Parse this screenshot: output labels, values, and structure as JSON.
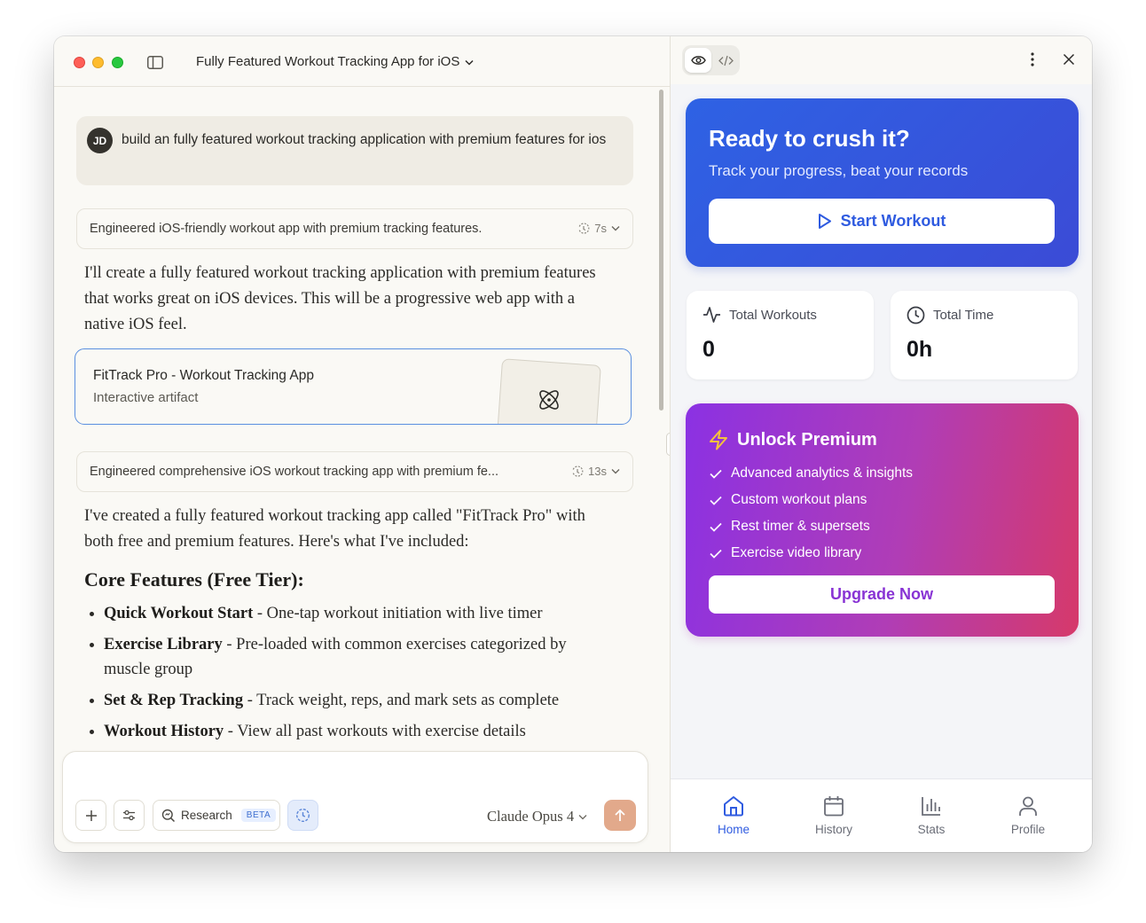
{
  "window": {
    "title": "Fully Featured Workout Tracking App for iOS"
  },
  "chat": {
    "user": {
      "initials": "JD",
      "message": "build an fully featured workout tracking application with premium features for ios"
    },
    "thinking_1": {
      "summary": "Engineered iOS-friendly workout app with premium tracking features.",
      "duration": "7s"
    },
    "response_1": "I'll create a fully featured workout tracking application with premium features that works great on iOS devices. This will be a progressive web app with a native iOS feel.",
    "artifact": {
      "title": "FitTrack Pro - Workout Tracking App",
      "subtitle": "Interactive artifact"
    },
    "thinking_2": {
      "summary": "Engineered comprehensive iOS workout tracking app with premium fe...",
      "duration": "13s"
    },
    "response_2": "I've created a fully featured workout tracking app called \"FitTrack Pro\" with both free and premium features. Here's what I've included:",
    "heading": "Core Features (Free Tier):",
    "features": [
      {
        "name": "Quick Workout Start",
        "desc": " - One-tap workout initiation with live timer"
      },
      {
        "name": "Exercise Library",
        "desc": " - Pre-loaded with common exercises categorized by muscle group"
      },
      {
        "name": "Set & Rep Tracking",
        "desc": " - Track weight, reps, and mark sets as complete"
      },
      {
        "name": "Workout History",
        "desc": " - View all past workouts with exercise details"
      }
    ]
  },
  "composer": {
    "research_label": "Research",
    "beta_label": "BETA",
    "model": "Claude Opus 4"
  },
  "app": {
    "hero": {
      "title": "Ready to crush it?",
      "subtitle": "Track your progress, beat your records",
      "button": "Start Workout"
    },
    "stats": [
      {
        "label": "Total Workouts",
        "value": "0",
        "icon": "activity-icon"
      },
      {
        "label": "Total Time",
        "value": "0h",
        "icon": "clock-icon"
      }
    ],
    "premium": {
      "title": "Unlock Premium",
      "items": [
        "Advanced analytics & insights",
        "Custom workout plans",
        "Rest timer & supersets",
        "Exercise video library"
      ],
      "button": "Upgrade Now"
    },
    "tabs": [
      {
        "label": "Home",
        "icon": "home-icon",
        "active": true
      },
      {
        "label": "History",
        "icon": "calendar-icon",
        "active": false
      },
      {
        "label": "Stats",
        "icon": "bar-chart-icon",
        "active": false
      },
      {
        "label": "Profile",
        "icon": "user-icon",
        "active": false
      }
    ]
  },
  "colors": {
    "accent_blue": "#2f5be0",
    "premium_start": "#8b31e3",
    "premium_end": "#d6396a",
    "send_button": "#e2a98b",
    "artifact_border": "#5a8fe0"
  }
}
